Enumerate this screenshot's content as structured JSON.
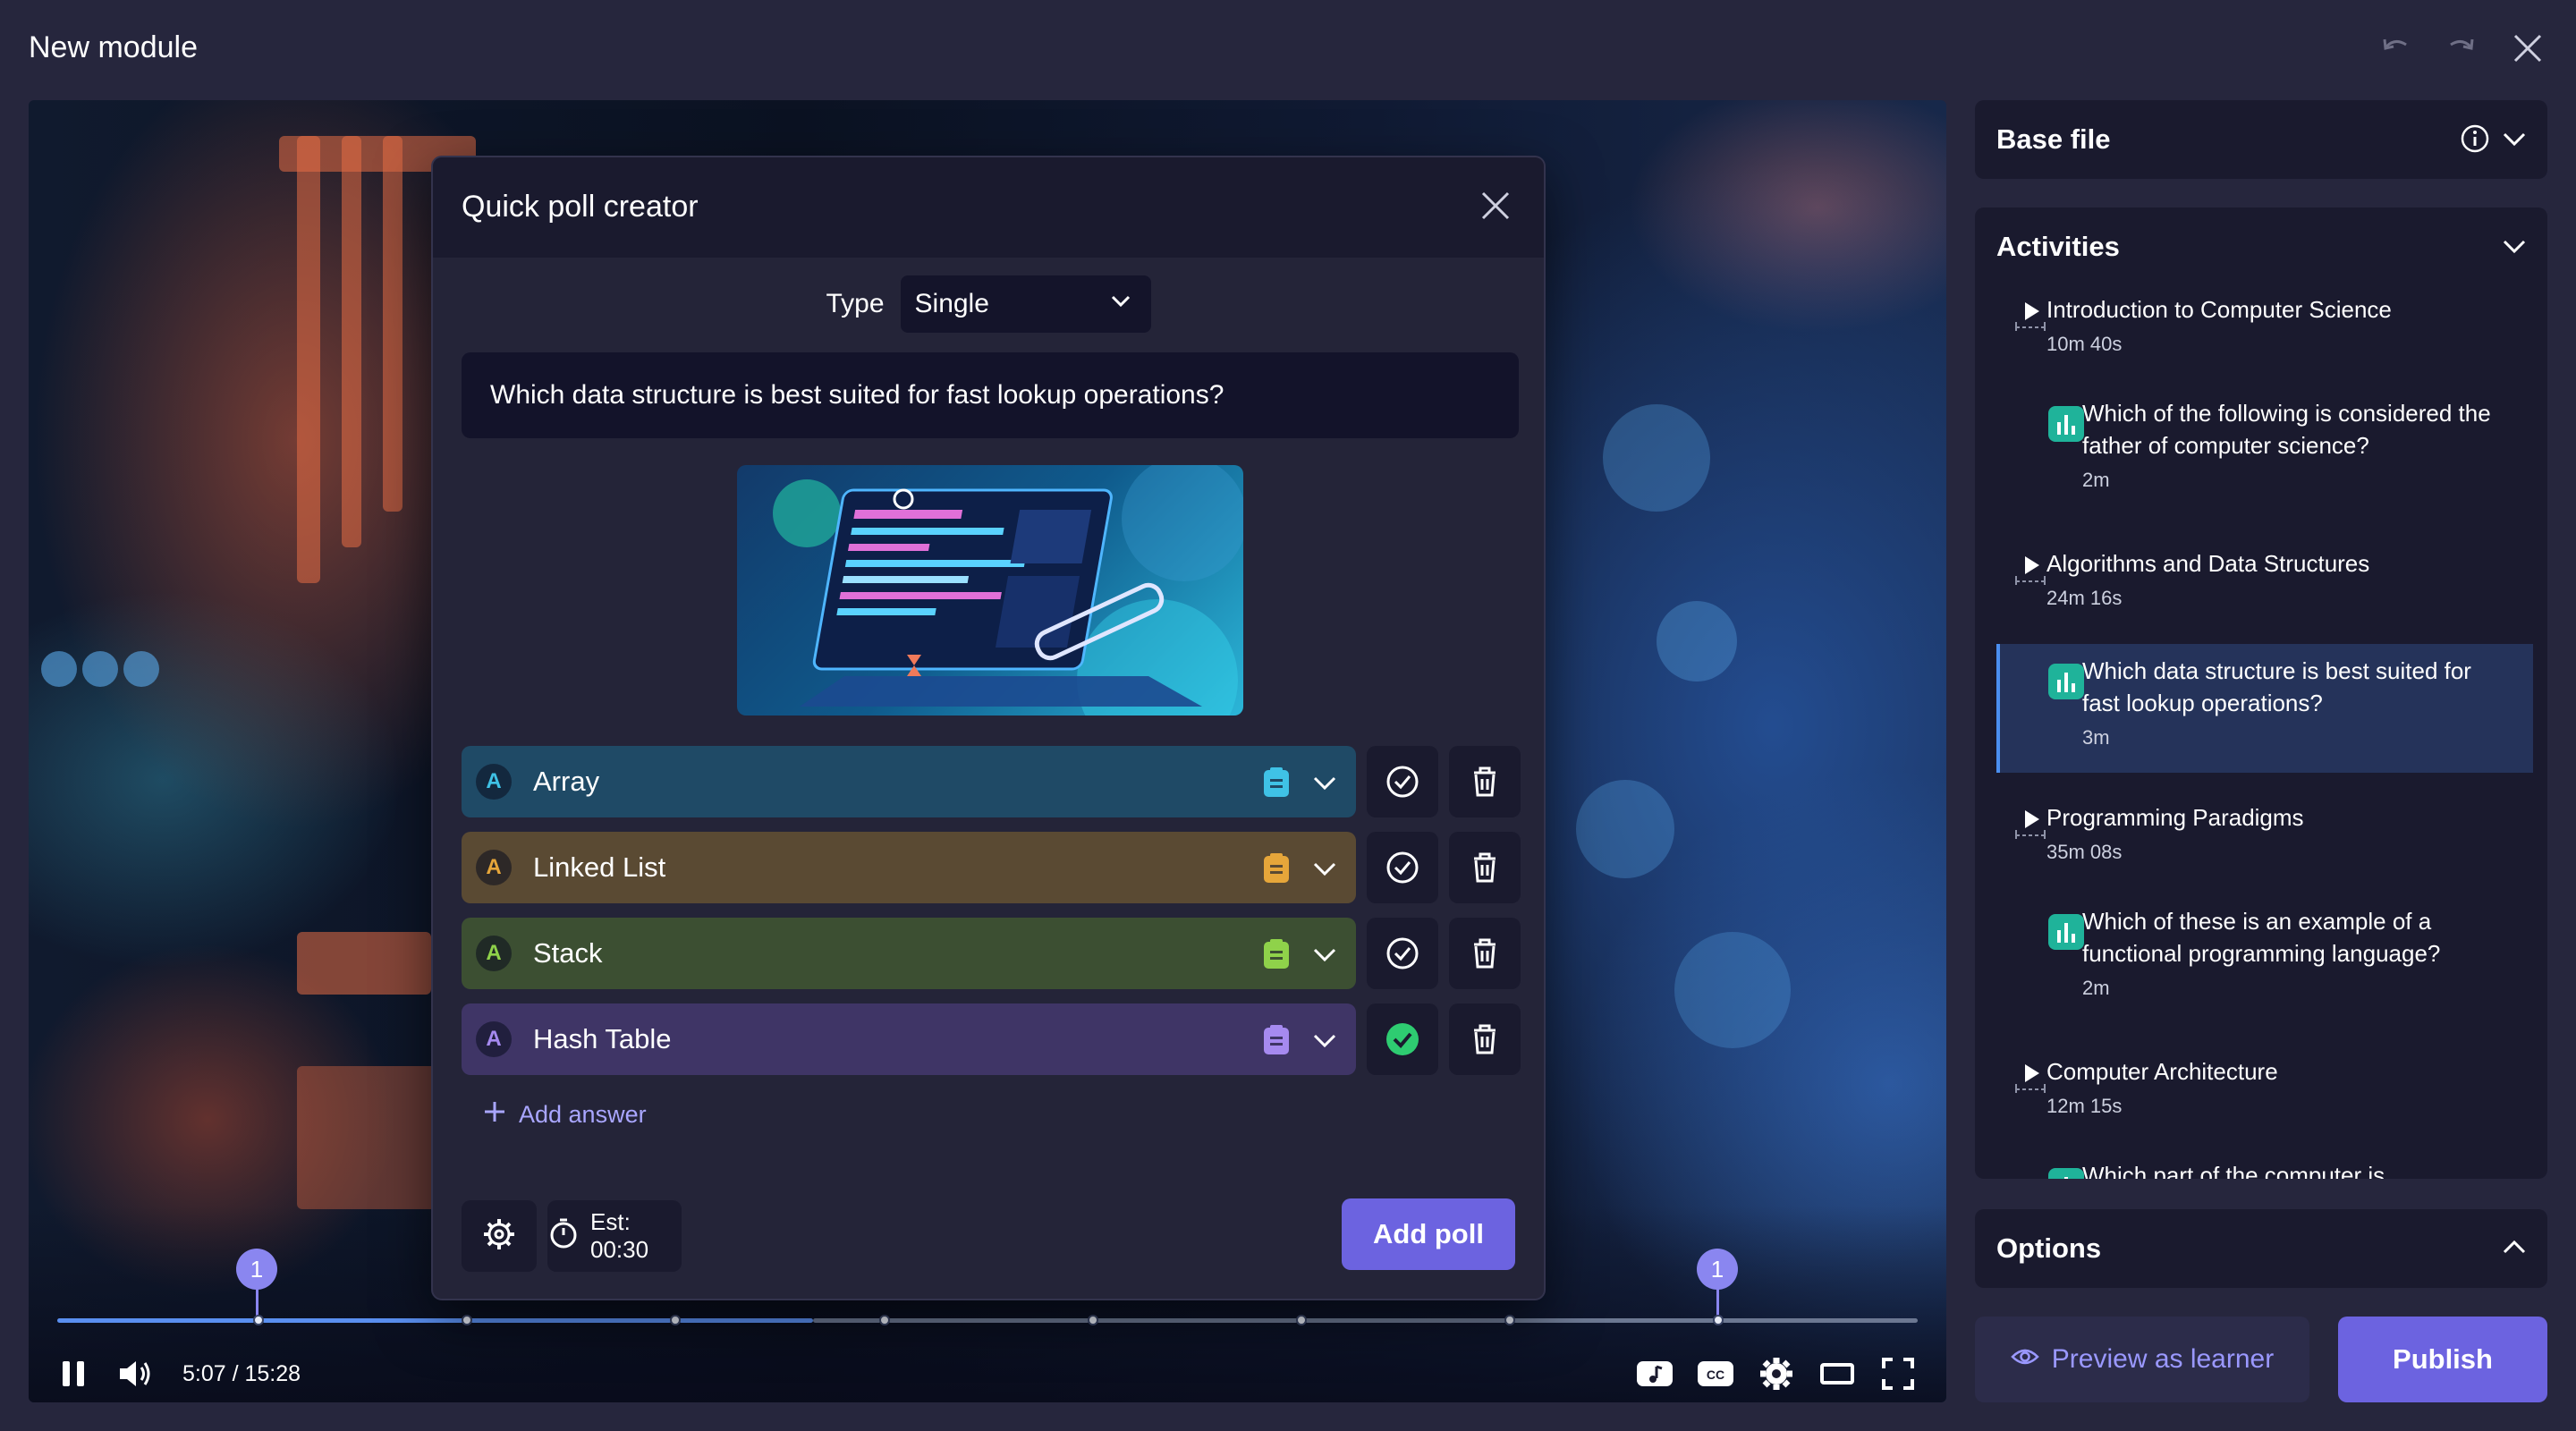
{
  "app": {
    "title": "New module"
  },
  "player": {
    "time": "5:07 / 15:28",
    "markers": [
      "1",
      "1"
    ],
    "progress_fraction": 0.33
  },
  "poll": {
    "title": "Quick poll creator",
    "type_label": "Type",
    "type_value": "Single",
    "question": "Which data structure is best suited for fast lookup operations?",
    "answers": [
      {
        "letter": "A",
        "label": "Array",
        "bg": "#1f4a66",
        "accent": "#3fc2e6",
        "correct": false
      },
      {
        "letter": "A",
        "label": "Linked List",
        "bg": "#5a4a33",
        "accent": "#e6a63a",
        "correct": false
      },
      {
        "letter": "A",
        "label": "Stack",
        "bg": "#3c4f32",
        "accent": "#8fd24a",
        "correct": false
      },
      {
        "letter": "A",
        "label": "Hash Table",
        "bg": "#3f3566",
        "accent": "#a68af0",
        "correct": true
      }
    ],
    "add_answer": "Add answer",
    "estimate": "Est: 00:30",
    "add_poll": "Add poll"
  },
  "sidebar": {
    "base_file": "Base file",
    "activities_title": "Activities",
    "activities": [
      {
        "kind": "video",
        "title": "Introduction to Computer Science",
        "time": "10m 40s"
      },
      {
        "kind": "poll",
        "title_lines": [
          "Which of the following is considered the",
          "father of computer science?"
        ],
        "time": "2m"
      },
      {
        "kind": "video",
        "title": "Algorithms and Data Structures",
        "time": "24m 16s"
      },
      {
        "kind": "poll",
        "title_lines": [
          "Which data structure is best suited for",
          "fast lookup operations?"
        ],
        "time": "3m",
        "selected": true
      },
      {
        "kind": "video",
        "title": "Programming Paradigms",
        "time": "35m 08s"
      },
      {
        "kind": "poll",
        "title_lines": [
          "Which of these is an example of a",
          "functional programming language?"
        ],
        "time": "2m"
      },
      {
        "kind": "video",
        "title": "Computer Architecture",
        "time": "12m 15s"
      },
      {
        "kind": "poll",
        "title_lines": [
          "Which part of the computer is"
        ],
        "time": ""
      }
    ],
    "options_title": "Options"
  },
  "footer": {
    "preview": "Preview as learner",
    "publish": "Publish"
  },
  "colors": {
    "accent": "#6c63e0",
    "poll_icon": "#1fb39a",
    "correct": "#2ecc71"
  }
}
